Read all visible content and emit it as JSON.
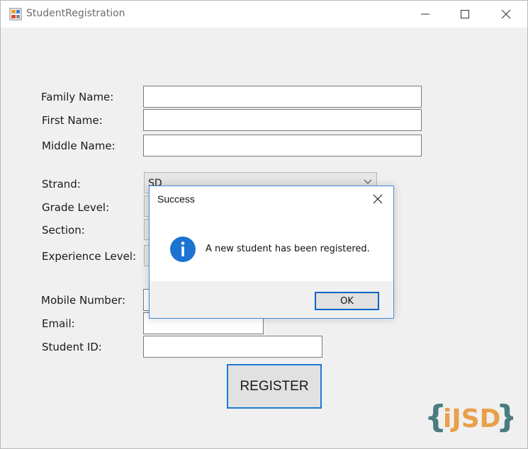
{
  "window": {
    "title": "StudentRegistration",
    "icon": "form-app-icon",
    "controls": [
      "minimize-icon",
      "maximize-icon",
      "close-icon"
    ]
  },
  "form": {
    "labels": {
      "family_name": "Family Name:",
      "first_name": "First Name:",
      "middle_name": "Middle Name:",
      "strand": "Strand:",
      "grade_level": "Grade Level:",
      "section": "Section:",
      "experience_level": "Experience Level:",
      "mobile_number": "Mobile Number:",
      "email": "Email:",
      "student_id": "Student ID:"
    },
    "values": {
      "family_name": "",
      "first_name": "",
      "middle_name": "",
      "strand": "SD",
      "grade_level": "",
      "section": "",
      "experience_level": "",
      "mobile_number": "",
      "email": "",
      "student_id": ""
    },
    "register_label": "REGISTER"
  },
  "dialog": {
    "title": "Success",
    "message": "A new student has been registered.",
    "icon": "info-icon",
    "ok_label": "OK"
  },
  "watermark": {
    "text": "{iJSD}",
    "colors": {
      "braces": "#4a7c80",
      "letters": "#e8a04b"
    }
  },
  "colors": {
    "window_bg": "#f0f0f0",
    "accent": "#1c7ad4",
    "info_blue": "#1c73d2"
  }
}
